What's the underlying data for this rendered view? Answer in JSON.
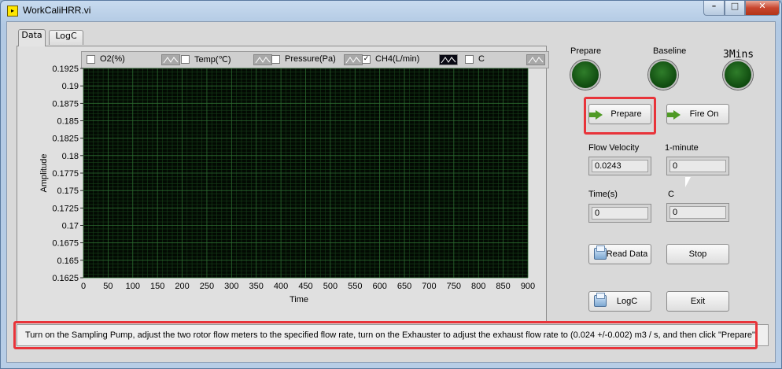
{
  "window": {
    "title": "WorkCaliHRR.vi",
    "minimize_glyph": "–",
    "maximize_glyph": "□",
    "close_glyph": "✕"
  },
  "tabs": [
    {
      "label": "Data",
      "active": true
    },
    {
      "label": "LogC",
      "active": false
    }
  ],
  "legend": [
    {
      "label": "O2(%)",
      "checked": false,
      "swatch_color": "#a8a8a8"
    },
    {
      "label": "Temp(℃)",
      "checked": false,
      "swatch_color": "#a8a8a8"
    },
    {
      "label": "Pressure(Pa)",
      "checked": false,
      "swatch_color": "#a8a8a8"
    },
    {
      "label": "CH4(L/min)",
      "checked": true,
      "swatch_color": "#0a0a14"
    },
    {
      "label": "C",
      "checked": false,
      "swatch_color": "#a8a8a8"
    }
  ],
  "chart_data": {
    "type": "line",
    "xlabel": "Time",
    "ylabel": "Amplitude",
    "xlim": [
      0,
      900
    ],
    "ylim": [
      0.1625,
      0.1925
    ],
    "x_ticks": [
      "0",
      "50",
      "100",
      "150",
      "200",
      "250",
      "300",
      "350",
      "400",
      "450",
      "500",
      "550",
      "600",
      "650",
      "700",
      "750",
      "800",
      "850",
      "900"
    ],
    "y_ticks": [
      "0.1925",
      "0.19",
      "0.1875",
      "0.185",
      "0.1825",
      "0.18",
      "0.1775",
      "0.175",
      "0.1725",
      "0.17",
      "0.1675",
      "0.165",
      "0.1625"
    ],
    "series": [],
    "grid": true,
    "plot_background": "#030a03",
    "grid_color": "#2c6a30"
  },
  "indicators": {
    "prepare_label": "Prepare",
    "baseline_label": "Baseline",
    "mins_label": "3Mins",
    "led_color": "#1f6a1c"
  },
  "buttons": {
    "prepare": "Prepare",
    "fire_on": "Fire On",
    "read_data": "Read Data",
    "stop": "Stop",
    "logc": "LogC",
    "exit": "Exit"
  },
  "fields": {
    "flow_velocity_label": "Flow Velocity",
    "flow_velocity_value": "0.0243",
    "one_minute_label": "1-minute",
    "one_minute_value": "0",
    "time_label": "Time(s)",
    "time_value": "0",
    "c_label": "C",
    "c_value": "0"
  },
  "status_message": "Turn on the Sampling Pump, adjust the two rotor flow meters to the specified flow rate, turn on the Exhauster to adjust the exhaust flow rate to (0.024 +/-0.002) m3 / s, and then click \"Prepare\".",
  "highlight_color": "#e8343a"
}
